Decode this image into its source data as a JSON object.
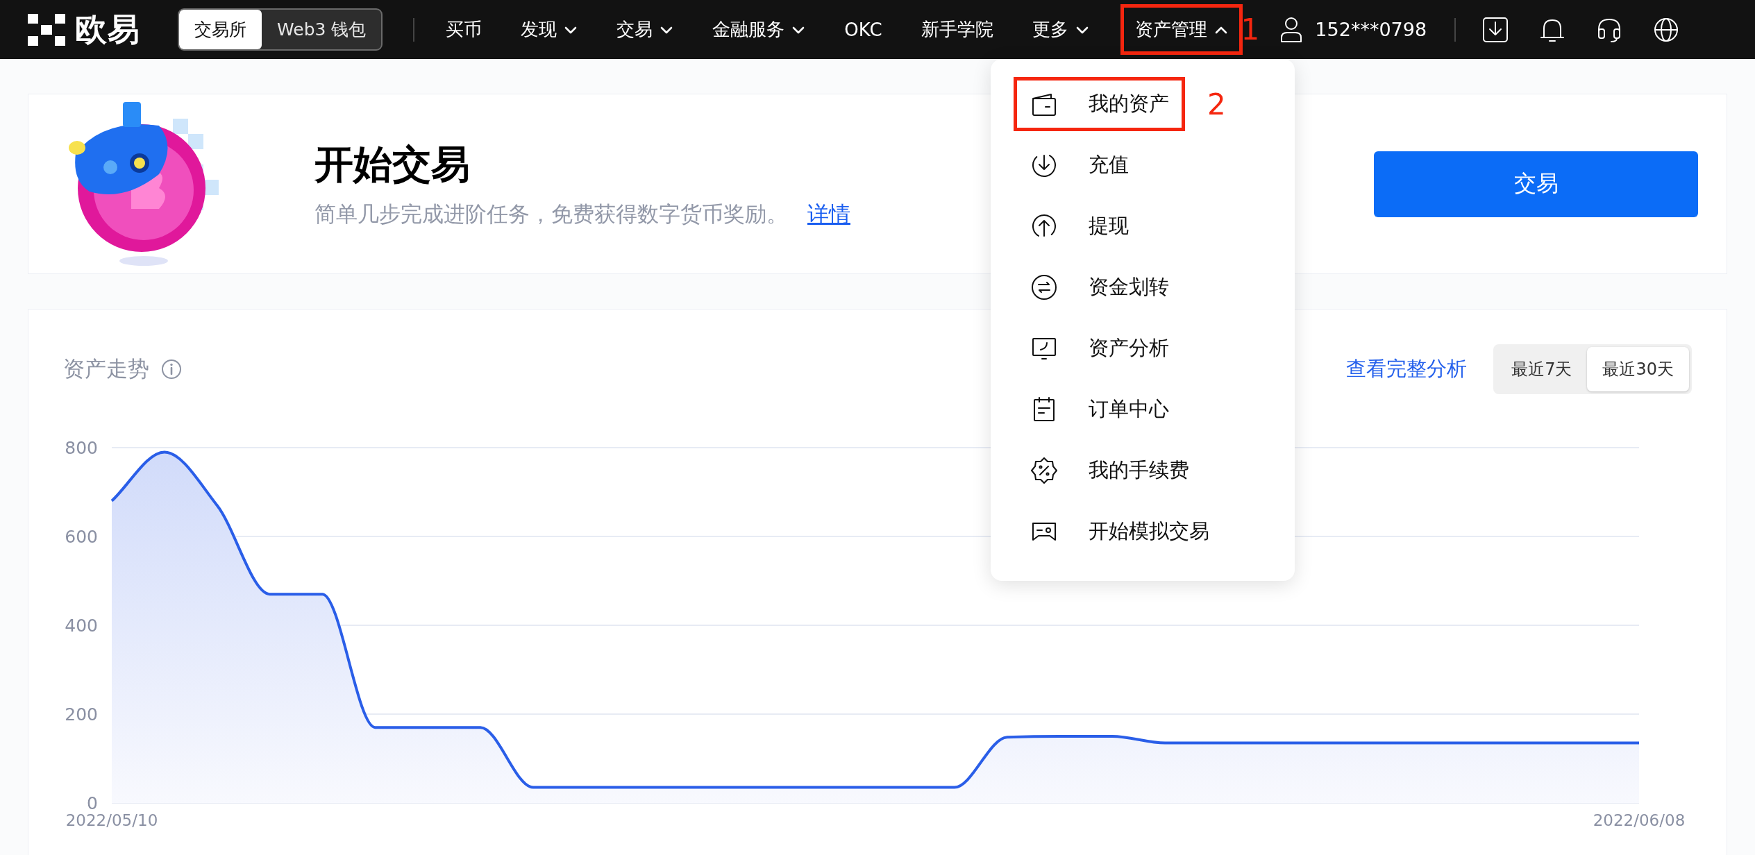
{
  "logo": {
    "text": "欧易"
  },
  "mode_toggle": [
    {
      "label": "交易所",
      "selected": true
    },
    {
      "label": "Web3 钱包",
      "selected": false
    }
  ],
  "nav": [
    {
      "label": "买币",
      "kind": "link",
      "highlighted": false
    },
    {
      "label": "发现",
      "kind": "dropdown",
      "expanded": false,
      "highlighted": false
    },
    {
      "label": "交易",
      "kind": "dropdown",
      "expanded": false,
      "highlighted": false
    },
    {
      "label": "金融服务",
      "kind": "dropdown",
      "expanded": false,
      "highlighted": false
    },
    {
      "label": "OKC",
      "kind": "link",
      "highlighted": false
    },
    {
      "label": "新手学院",
      "kind": "link",
      "highlighted": false
    },
    {
      "label": "更多",
      "kind": "dropdown",
      "expanded": false,
      "highlighted": false
    },
    {
      "label": "资产管理",
      "kind": "dropdown",
      "expanded": true,
      "highlighted": true,
      "callout": "1"
    }
  ],
  "account": {
    "phone": "152***0798"
  },
  "asset_menu": {
    "items": [
      {
        "label": "我的资产",
        "highlighted": true,
        "callout": "2"
      },
      {
        "label": "充值",
        "highlighted": false
      },
      {
        "label": "提现",
        "highlighted": false
      },
      {
        "label": "资金划转",
        "highlighted": false
      },
      {
        "label": "资产分析",
        "highlighted": false
      },
      {
        "label": "订单中心",
        "highlighted": false
      },
      {
        "label": "我的手续费",
        "highlighted": false
      },
      {
        "label": "开始模拟交易",
        "highlighted": false
      }
    ]
  },
  "banner": {
    "title": "开始交易",
    "subtitle": "简单几步完成进阶任务，免费获得数字货币奖励。",
    "link": "详情",
    "button": "交易"
  },
  "asset_chart": {
    "title": "资产走势",
    "link": "查看完整分析",
    "ranges": [
      {
        "label": "最近7天",
        "selected": false
      },
      {
        "label": "最近30天",
        "selected": true
      }
    ],
    "chart_data": {
      "type": "area",
      "grid": true,
      "categories": [
        "2022/05/10",
        null,
        null,
        null,
        null,
        null,
        null,
        null,
        null,
        null,
        null,
        null,
        null,
        null,
        null,
        null,
        null,
        null,
        null,
        null,
        null,
        null,
        null,
        null,
        null,
        null,
        null,
        null,
        null,
        "2022/06/08"
      ],
      "ylim": [
        0,
        800
      ],
      "yticks": [
        0,
        200,
        400,
        600,
        800
      ],
      "series": [
        {
          "color": "#2a5ee8",
          "values": [
            680,
            790,
            670,
            470,
            470,
            170,
            170,
            170,
            35,
            35,
            35,
            35,
            35,
            35,
            35,
            35,
            35,
            148,
            150,
            150,
            135,
            135,
            135,
            135,
            135,
            135,
            135,
            135,
            135,
            135
          ]
        }
      ]
    }
  }
}
